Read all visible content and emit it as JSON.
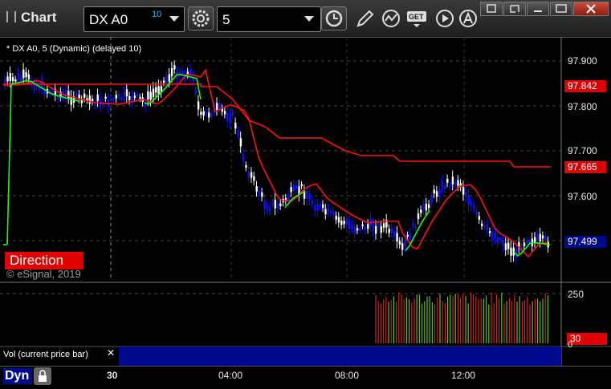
{
  "app": {
    "title": "Chart"
  },
  "toolbar": {
    "symbol": "DX A0",
    "symbol_delay": "10",
    "interval": "5",
    "get_label": "GET"
  },
  "chart": {
    "label": "* DX A0, 5 (Dynamic) (delayed 10)",
    "y_ticks": [
      "97.900",
      "97.800",
      "97.700",
      "97.600"
    ],
    "price_tags": [
      {
        "text": "97.842",
        "bg": "#e00000",
        "fg": "#ffffff"
      },
      {
        "text": "97.665",
        "bg": "#e00000",
        "fg": "#ffffff"
      },
      {
        "text": "97.499",
        "bg": "#000a8c",
        "fg": "#ffffff"
      }
    ],
    "direction_label": "Direction",
    "copyright": "© eSignal, 2019"
  },
  "volume": {
    "label": "Vol (current price bar)",
    "ticks": [
      "250",
      "0"
    ],
    "tag": "30",
    "tag_bg": "#e00000"
  },
  "x_axis": {
    "labels": [
      "30",
      "04:00",
      "08:00",
      "12:00"
    ]
  },
  "status": {
    "mode": "Dyn"
  },
  "colors": {
    "up_candle": "#ffffff",
    "down_candle": "#1010ff",
    "red_line": "#ff1010",
    "green_line": "#10ff10",
    "vol_up": "#60c020",
    "vol_down": "#d02020"
  },
  "icons": [
    "settings-gear-icon",
    "clock-icon",
    "pencil-icon",
    "study-icon",
    "get-icon",
    "play-icon",
    "alert-icon",
    "restore-icon",
    "link-icon",
    "minimize-icon",
    "maximize-icon",
    "close-icon",
    "lock-icon"
  ]
}
